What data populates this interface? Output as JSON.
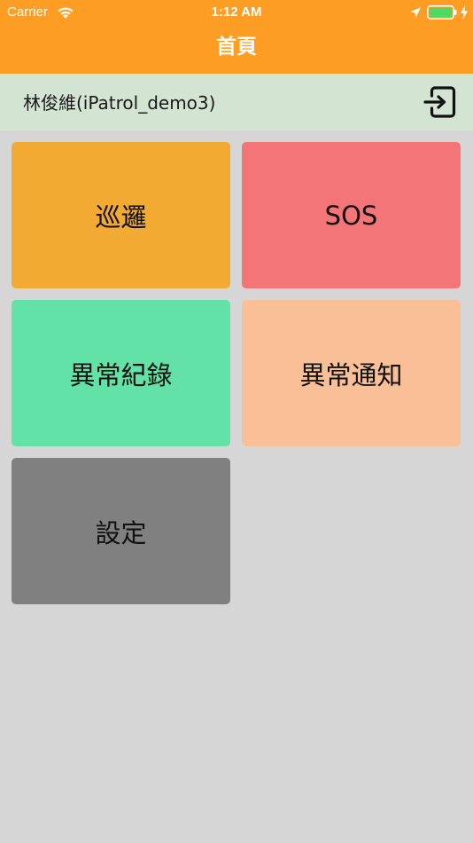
{
  "status_bar": {
    "carrier": "Carrier",
    "time": "1:12 AM",
    "wifi_icon": "wifi-icon",
    "location_icon": "location-arrow-icon",
    "battery_icon": "battery-full-icon",
    "charging_icon": "charging-bolt-icon"
  },
  "header": {
    "title": "首頁",
    "background_color": "#fe9d23"
  },
  "user_bar": {
    "name": "林俊維(iPatrol_demo3)",
    "logout_icon": "logout-icon",
    "background_color": "#d4e4d2"
  },
  "menu": {
    "tiles": [
      {
        "label": "巡邏",
        "color": "#f2aa33"
      },
      {
        "label": "SOS",
        "color": "#f37578"
      },
      {
        "label": "異常紀錄",
        "color": "#62e2a6"
      },
      {
        "label": "異常通知",
        "color": "#f9bf97"
      },
      {
        "label": "設定",
        "color": "#808080"
      }
    ]
  }
}
